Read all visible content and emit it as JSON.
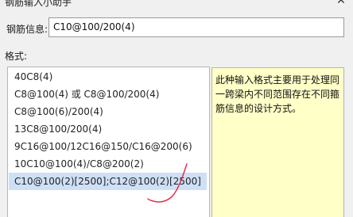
{
  "window": {
    "title": "钢筋输入小助手",
    "close_glyph": "✕"
  },
  "rebar_info": {
    "label": "钢筋信息:",
    "value": "C10@100/200(4)"
  },
  "format": {
    "label": "格式:",
    "items": [
      {
        "text": "40C8(4)",
        "selected": false
      },
      {
        "text": "C8@100(4) 或 C8@100/200(4)",
        "selected": false
      },
      {
        "text": "C8@100(6)/200(4)",
        "selected": false
      },
      {
        "text": "13C8@100/200(4)",
        "selected": false
      },
      {
        "text": "9C16@100/12C16@150/C16@200(6)",
        "selected": false
      },
      {
        "text": "10C10@100(4)/C8@200(2)",
        "selected": false
      },
      {
        "text": "C10@100(2)[2500];C12@100(2)[2500]",
        "selected": true
      }
    ]
  },
  "description": {
    "text": "此种输入格式主要用于处理同一跨梁内不同范围存在不同箍筋信息的设计方式。"
  },
  "colors": {
    "selection": "#cfe0f6",
    "description_bg": "#ffffc8",
    "annotation_red": "#e0304a"
  }
}
